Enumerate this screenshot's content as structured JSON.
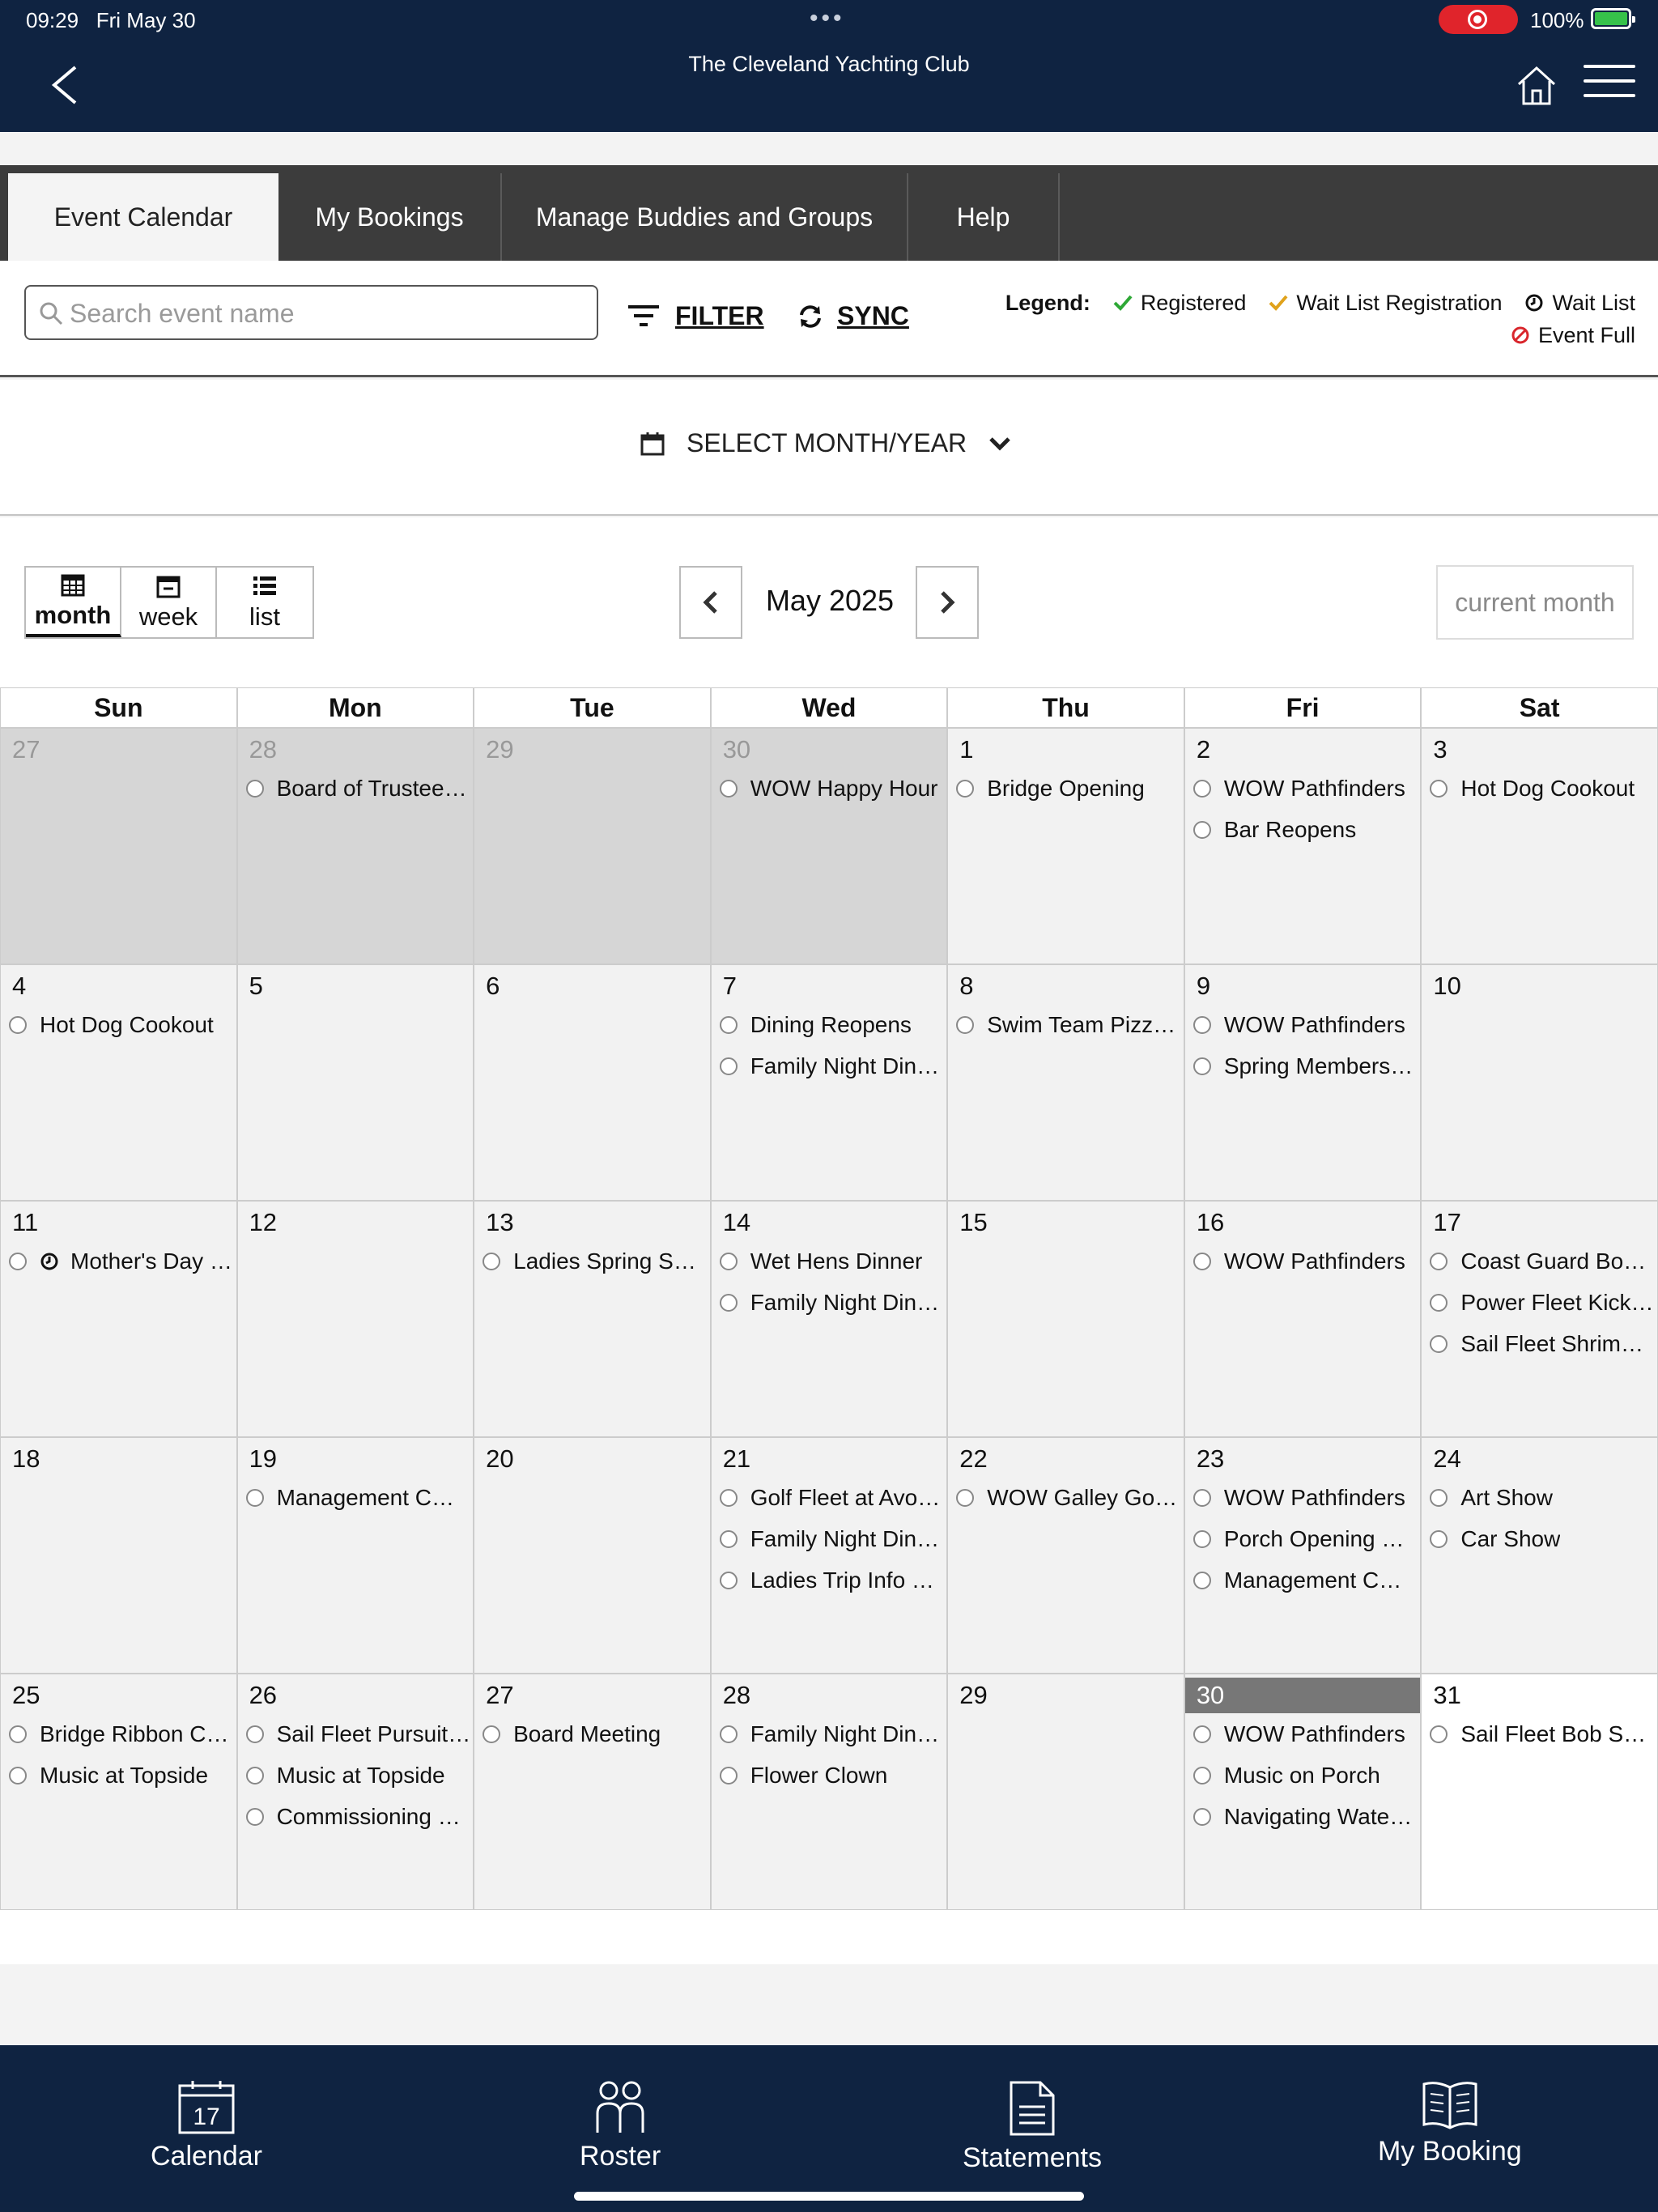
{
  "status": {
    "time": "09:29",
    "date": "Fri May 30",
    "battery": "100%"
  },
  "app": {
    "title": "The Cleveland Yachting Club"
  },
  "tabs": [
    {
      "label": "Event Calendar"
    },
    {
      "label": "My Bookings"
    },
    {
      "label": "Manage Buddies and Groups"
    },
    {
      "label": "Help"
    }
  ],
  "toolbar": {
    "search_placeholder": "Search event name",
    "filter_label": "FILTER",
    "sync_label": "SYNC"
  },
  "legend": {
    "title": "Legend:",
    "registered": "Registered",
    "waitlist_registration": "Wait List Registration",
    "waitlist": "Wait List",
    "event_full": "Event Full",
    "colors": {
      "registered": "#2ea836",
      "waitlist_registration": "#e0a21b",
      "event_full": "#d9262c"
    }
  },
  "month_select": {
    "label": "SELECT MONTH/YEAR"
  },
  "views": {
    "month": "month",
    "week": "week",
    "list": "list"
  },
  "nav": {
    "month_label": "May 2025",
    "current_month": "current month"
  },
  "calendar": {
    "days_of_week": [
      "Sun",
      "Mon",
      "Tue",
      "Wed",
      "Thu",
      "Fri",
      "Sat"
    ],
    "weeks": [
      [
        {
          "num": "27",
          "type": "other",
          "events": []
        },
        {
          "num": "28",
          "type": "other",
          "events": [
            {
              "title": "Board of Trustees Meeting"
            }
          ]
        },
        {
          "num": "29",
          "type": "other",
          "events": []
        },
        {
          "num": "30",
          "type": "other",
          "events": [
            {
              "title": "WOW Happy Hour"
            }
          ]
        },
        {
          "num": "1",
          "type": "past",
          "events": [
            {
              "title": "Bridge Opening"
            }
          ]
        },
        {
          "num": "2",
          "type": "past",
          "events": [
            {
              "title": "WOW Pathfinders"
            },
            {
              "title": "Bar Reopens"
            }
          ]
        },
        {
          "num": "3",
          "type": "past",
          "events": [
            {
              "title": "Hot Dog Cookout"
            }
          ]
        }
      ],
      [
        {
          "num": "4",
          "type": "past",
          "events": [
            {
              "title": "Hot Dog Cookout"
            }
          ]
        },
        {
          "num": "5",
          "type": "past",
          "events": []
        },
        {
          "num": "6",
          "type": "past",
          "events": []
        },
        {
          "num": "7",
          "type": "past",
          "events": [
            {
              "title": "Dining Reopens"
            },
            {
              "title": "Family Night Dinner"
            }
          ]
        },
        {
          "num": "8",
          "type": "past",
          "events": [
            {
              "title": "Swim Team Pizza Party"
            }
          ]
        },
        {
          "num": "9",
          "type": "past",
          "events": [
            {
              "title": "WOW Pathfinders"
            },
            {
              "title": "Spring Membership Party"
            }
          ]
        },
        {
          "num": "10",
          "type": "past",
          "events": []
        }
      ],
      [
        {
          "num": "11",
          "type": "past",
          "events": [
            {
              "title": "Mother's Day Brunch",
              "waitlist": true
            }
          ]
        },
        {
          "num": "12",
          "type": "past",
          "events": []
        },
        {
          "num": "13",
          "type": "past",
          "events": [
            {
              "title": "Ladies Spring Social"
            }
          ]
        },
        {
          "num": "14",
          "type": "past",
          "events": [
            {
              "title": "Wet Hens Dinner"
            },
            {
              "title": "Family Night Dinner"
            }
          ]
        },
        {
          "num": "15",
          "type": "past",
          "events": []
        },
        {
          "num": "16",
          "type": "past",
          "events": [
            {
              "title": "WOW Pathfinders"
            }
          ]
        },
        {
          "num": "17",
          "type": "past",
          "events": [
            {
              "title": "Coast Guard Boat Inspection"
            },
            {
              "title": "Power Fleet Kick Off"
            },
            {
              "title": "Sail Fleet Shrimp Boil"
            }
          ]
        }
      ],
      [
        {
          "num": "18",
          "type": "past",
          "events": []
        },
        {
          "num": "19",
          "type": "past",
          "events": [
            {
              "title": "Management Cmte Meeting"
            }
          ]
        },
        {
          "num": "20",
          "type": "past",
          "events": []
        },
        {
          "num": "21",
          "type": "past",
          "events": [
            {
              "title": "Golf Fleet at Avon Oaks"
            },
            {
              "title": "Family Night Dinner"
            },
            {
              "title": "Ladies Trip Info Session"
            }
          ]
        },
        {
          "num": "22",
          "type": "past",
          "events": [
            {
              "title": "WOW Galley Gourmet"
            }
          ]
        },
        {
          "num": "23",
          "type": "past",
          "events": [
            {
              "title": "WOW Pathfinders"
            },
            {
              "title": "Porch Opening Party"
            },
            {
              "title": "Management Cmte Meeting"
            }
          ]
        },
        {
          "num": "24",
          "type": "past",
          "events": [
            {
              "title": "Art Show"
            },
            {
              "title": "Car Show"
            }
          ]
        }
      ],
      [
        {
          "num": "25",
          "type": "past",
          "events": [
            {
              "title": "Bridge Ribbon Cutting"
            },
            {
              "title": "Music at Topside"
            }
          ]
        },
        {
          "num": "26",
          "type": "past",
          "events": [
            {
              "title": "Sail Fleet Pursuit Race"
            },
            {
              "title": "Music at Topside"
            },
            {
              "title": "Commissioning Ceremony"
            }
          ]
        },
        {
          "num": "27",
          "type": "past",
          "events": [
            {
              "title": "Board Meeting"
            }
          ]
        },
        {
          "num": "28",
          "type": "past",
          "events": [
            {
              "title": "Family Night Dinner"
            },
            {
              "title": "Flower Clown"
            }
          ]
        },
        {
          "num": "29",
          "type": "past",
          "events": []
        },
        {
          "num": "30",
          "type": "today",
          "events": [
            {
              "title": "WOW Pathfinders"
            },
            {
              "title": "Music on Porch"
            },
            {
              "title": "Navigating Waterways"
            }
          ]
        },
        {
          "num": "31",
          "type": "future",
          "events": [
            {
              "title": "Sail Fleet Bob Schmidt"
            }
          ]
        }
      ]
    ]
  },
  "bottom_nav": [
    {
      "label": "Calendar",
      "icon": "calendar-icon",
      "badge": "17"
    },
    {
      "label": "Roster",
      "icon": "people-icon"
    },
    {
      "label": "Statements",
      "icon": "document-icon"
    },
    {
      "label": "My Booking",
      "icon": "book-icon"
    }
  ]
}
